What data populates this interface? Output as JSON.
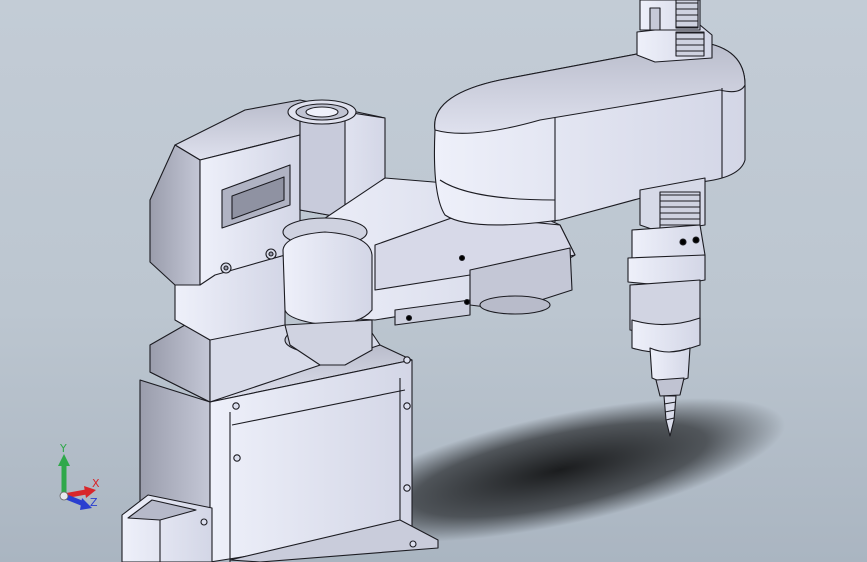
{
  "viewport": {
    "background_top": "#c3ccd6",
    "background_bottom": "#aab5c1",
    "model_color": "#e2e4f0",
    "edge_color": "#1c1c22"
  },
  "triad": {
    "x_label": "X",
    "y_label": "Y",
    "z_label": "Z",
    "x_color": "#d8262a",
    "y_color": "#2fa84a",
    "z_color": "#2a3fd0"
  }
}
